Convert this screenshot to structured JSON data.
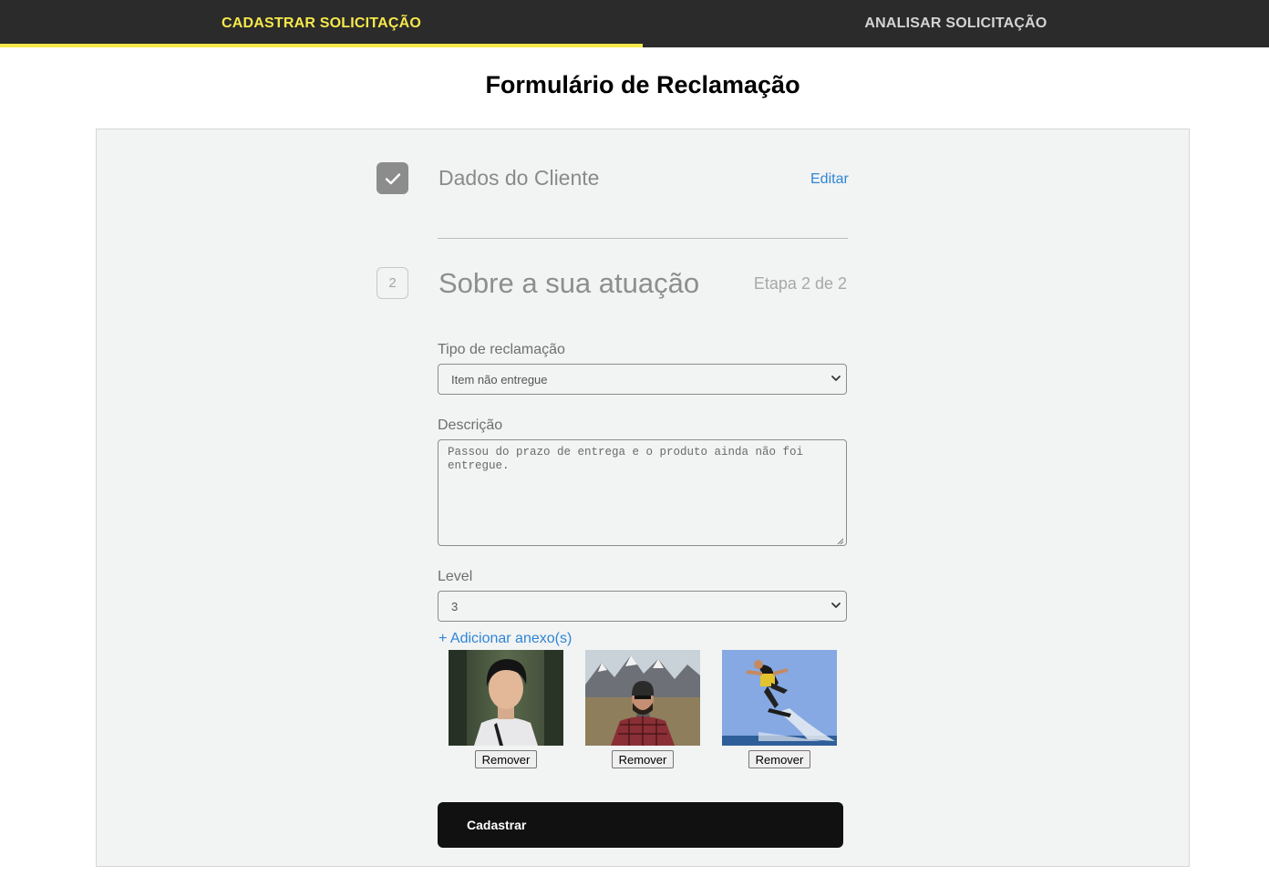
{
  "nav": {
    "tabs": [
      {
        "label": "CADASTRAR SOLICITAÇÃO",
        "active": true
      },
      {
        "label": "ANALISAR SOLICITAÇÃO",
        "active": false
      }
    ],
    "accent_color": "#f7e84b"
  },
  "page": {
    "title": "Formulário de Reclamação"
  },
  "step1": {
    "icon": "check-icon",
    "title": "Dados do Cliente",
    "edit_label": "Editar"
  },
  "step2": {
    "number": "2",
    "title": "Sobre a sua atuação",
    "progress": "Etapa 2 de 2"
  },
  "form": {
    "tipo": {
      "label": "Tipo de reclamação",
      "value": "Item não entregue"
    },
    "descricao": {
      "label": "Descrição",
      "value": "Passou do prazo de entrega e o produto ainda não foi entregue."
    },
    "level": {
      "label": "Level",
      "value": "3"
    },
    "add_attachment_label": "+ Adicionar anexo(s)",
    "attachments": [
      {
        "image": "portrait-young-man-photo",
        "remove_label": "Remover"
      },
      {
        "image": "man-road-mountains-photo",
        "remove_label": "Remover"
      },
      {
        "image": "flyboard-rider-photo",
        "remove_label": "Remover"
      }
    ],
    "submit_label": "Cadastrar"
  }
}
